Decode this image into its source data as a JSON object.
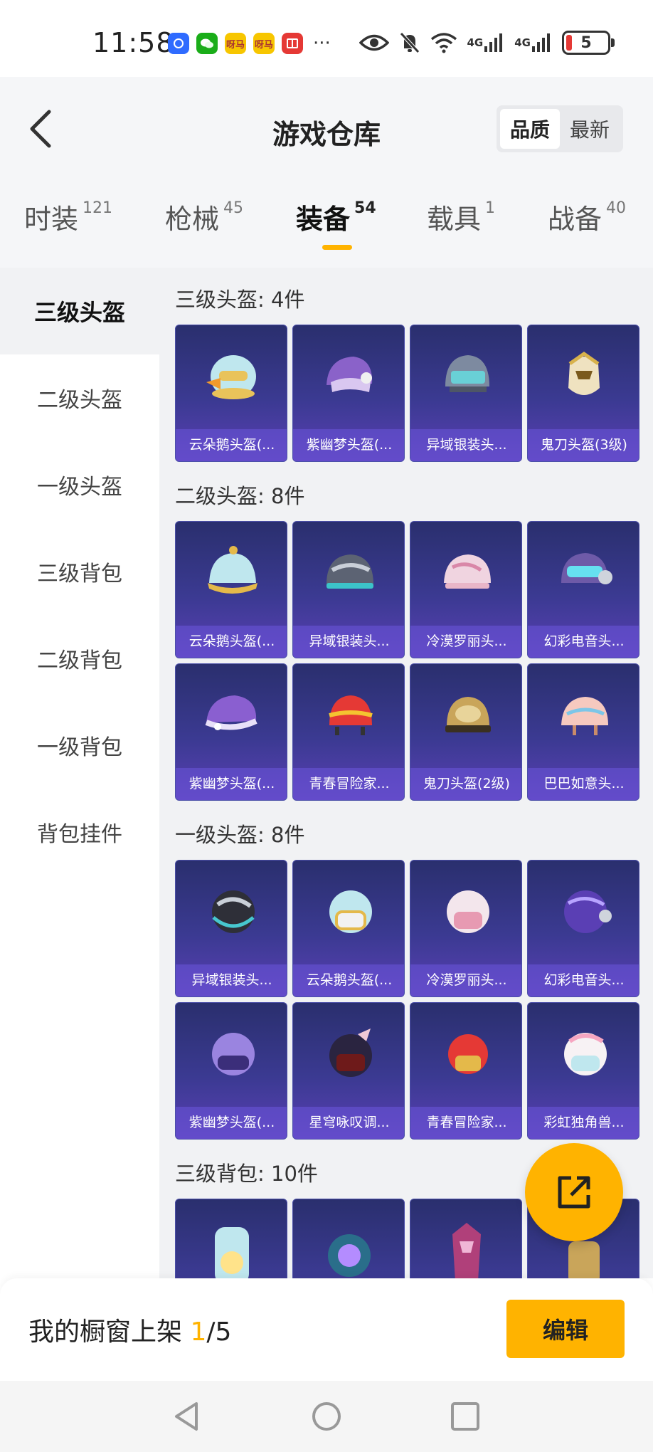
{
  "status_bar": {
    "time": "11:58",
    "apps": [
      {
        "icon": "app-blue-icon",
        "color": "#2f6bff",
        "text": ""
      },
      {
        "icon": "wechat-icon",
        "color": "#1aad19",
        "text": ""
      },
      {
        "icon": "app-game-icon",
        "color": "#f7c600",
        "text": "呀马"
      },
      {
        "icon": "app-game-icon-2",
        "color": "#f7c600",
        "text": "呀马"
      },
      {
        "icon": "book-icon",
        "color": "#e53935",
        "text": ""
      }
    ],
    "more": "···",
    "network_1": "4G",
    "network_2": "4G",
    "battery": "5"
  },
  "header": {
    "title": "游戏仓库",
    "sort_options": [
      "品质",
      "最新"
    ],
    "active_sort": "品质"
  },
  "tabs": [
    {
      "label": "时装",
      "count": "121"
    },
    {
      "label": "枪械",
      "count": "45"
    },
    {
      "label": "装备",
      "count": "54"
    },
    {
      "label": "载具",
      "count": "1"
    },
    {
      "label": "战备",
      "count": "40"
    }
  ],
  "active_tab": "装备",
  "sidebar": {
    "items": [
      "三级头盔",
      "二级头盔",
      "一级头盔",
      "三级背包",
      "二级背包",
      "一级背包",
      "背包挂件"
    ],
    "active": "三级头盔"
  },
  "sections": [
    {
      "title": "三级头盔: 4件",
      "items": [
        "云朵鹅头盔(...",
        "紫幽梦头盔(...",
        "异域银装头...",
        "鬼刀头盔(3级)"
      ]
    },
    {
      "title": "二级头盔: 8件",
      "items": [
        "云朵鹅头盔(...",
        "异域银装头...",
        "冷漠罗丽头...",
        "幻彩电音头...",
        "紫幽梦头盔(...",
        "青春冒险家...",
        "鬼刀头盔(2级)",
        "巴巴如意头..."
      ]
    },
    {
      "title": "一级头盔: 8件",
      "items": [
        "异域银装头...",
        "云朵鹅头盔(...",
        "冷漠罗丽头...",
        "幻彩电音头...",
        "紫幽梦头盔(...",
        "星穹咏叹调...",
        "青春冒险家...",
        "彩虹独角兽..."
      ]
    },
    {
      "title": "三级背包: 10件",
      "items": [
        "",
        "",
        "",
        ""
      ]
    }
  ],
  "bottom_bar": {
    "shelf_label": "我的橱窗上架",
    "shelf_current": "1",
    "shelf_total": "/5",
    "edit_label": "编辑"
  },
  "colors": {
    "accent": "#ffb300",
    "card_bg": "#3b3a92",
    "page_bg": "#f1f2f4"
  }
}
